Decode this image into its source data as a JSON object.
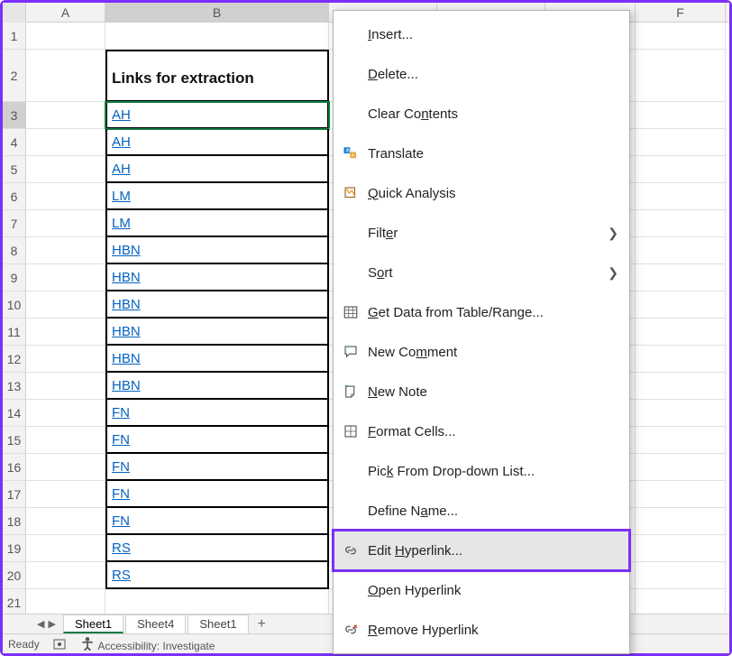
{
  "columns": {
    "A": "A",
    "B": "B",
    "F": "F"
  },
  "row_numbers": [
    "1",
    "2",
    "3",
    "4",
    "5",
    "6",
    "7",
    "8",
    "9",
    "10",
    "11",
    "12",
    "13",
    "14",
    "15",
    "16",
    "17",
    "18",
    "19",
    "20",
    "21"
  ],
  "b_header": "Links for extraction",
  "b_values": [
    "AH",
    "AH",
    "AH",
    "LM",
    "LM",
    "HBN",
    "HBN",
    "HBN",
    "HBN",
    "HBN",
    "HBN",
    "FN",
    "FN",
    "FN",
    "FN",
    "FN",
    "RS",
    "RS"
  ],
  "selected_row_index": 2,
  "tabs": [
    "Sheet1",
    "Sheet4",
    "Sheet1"
  ],
  "active_tab_index": 0,
  "status": {
    "ready": "Ready",
    "accessibility": "Accessibility: Investigate"
  },
  "menu": {
    "insert": "Insert...",
    "delete": "Delete...",
    "clear": "Clear Contents",
    "translate": "Translate",
    "quick_analysis": "Quick Analysis",
    "filter": "Filter",
    "sort": "Sort",
    "get_data": "Get Data from Table/Range...",
    "new_comment": "New Comment",
    "new_note": "New Note",
    "format_cells": "Format Cells...",
    "pick_list": "Pick From Drop-down List...",
    "define_name": "Define Name...",
    "edit_hyperlink": "Edit Hyperlink...",
    "open_hyperlink": "Open Hyperlink",
    "remove_hyperlink": "Remove Hyperlink"
  }
}
